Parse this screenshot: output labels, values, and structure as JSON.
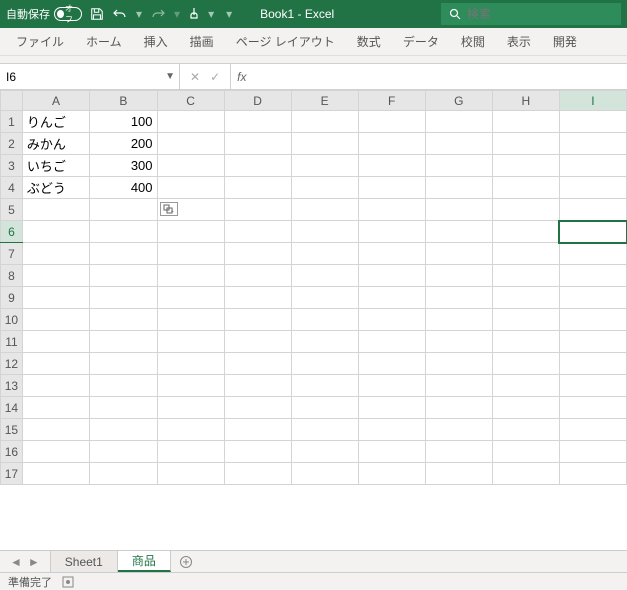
{
  "titlebar": {
    "autosave_label": "自動保存",
    "autosave_state": "オフ",
    "title": "Book1  -  Excel",
    "search_placeholder": "検索"
  },
  "ribbon": {
    "tabs": [
      "ファイル",
      "ホーム",
      "挿入",
      "描画",
      "ページ レイアウト",
      "数式",
      "データ",
      "校閲",
      "表示",
      "開発"
    ]
  },
  "namebox": {
    "value": "I6"
  },
  "fx": {
    "label": "fx",
    "value": ""
  },
  "columns": [
    "A",
    "B",
    "C",
    "D",
    "E",
    "F",
    "G",
    "H",
    "I"
  ],
  "row_count": 17,
  "selected": {
    "row": 6,
    "col": "I"
  },
  "cells": {
    "A1": "りんご",
    "B1": "100",
    "A2": "みかん",
    "B2": "200",
    "A3": "いちご",
    "B3": "300",
    "A4": "ぶどう",
    "B4": "400"
  },
  "autofill_icon_pos": {
    "row": 5,
    "col": "C"
  },
  "sheets": {
    "tabs": [
      {
        "name": "Sheet1",
        "active": false
      },
      {
        "name": "商品",
        "active": true
      }
    ]
  },
  "statusbar": {
    "ready": "準備完了"
  }
}
